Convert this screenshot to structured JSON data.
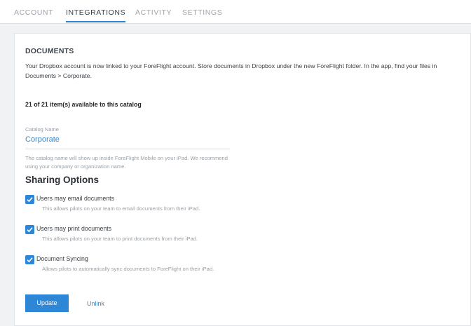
{
  "tabs": {
    "account": "ACCOUNT",
    "integrations": "INTEGRATIONS",
    "activity": "ACTIVITY",
    "settings": "SETTINGS"
  },
  "documents": {
    "title": "DOCUMENTS",
    "description": "Your Dropbox account is now linked to your ForeFlight account. Store documents in Dropbox under the new ForeFlight folder. In the app, find your files in Documents > Corporate.",
    "count_text": "21 of 21 item(s) available to this catalog"
  },
  "catalog": {
    "label": "Catalog Name",
    "value": "Corporate",
    "help": "The catalog name will show up inside ForeFlight Mobile on your iPad. We recommend using your company or organization name."
  },
  "sharing": {
    "title": "Sharing Options",
    "options": [
      {
        "label": "Users may email documents",
        "help": "This allows pilots on your team to email documents from their iPad.",
        "checked": true
      },
      {
        "label": "Users may print documents",
        "help": "This allows pilots on your team to print documents from their iPad.",
        "checked": true
      },
      {
        "label": "Document Syncing",
        "help": "Allows pilots to automatically sync documents to ForeFlight on their iPad.",
        "checked": true
      }
    ]
  },
  "actions": {
    "update": "Update",
    "unlink": "Unlink"
  },
  "colors": {
    "accent": "#2d86d6",
    "link": "#3a86c8"
  }
}
